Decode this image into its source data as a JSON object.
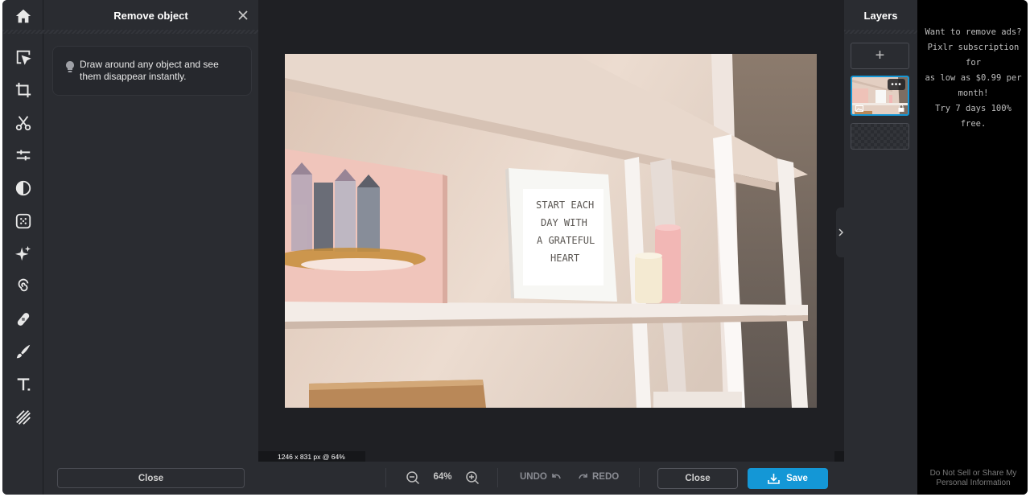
{
  "toolbar": {
    "items": [
      {
        "name": "home-icon"
      },
      {
        "name": "arrange-icon"
      },
      {
        "name": "crop-icon"
      },
      {
        "name": "cutout-icon"
      },
      {
        "name": "adjust-icon"
      },
      {
        "name": "filter-icon"
      },
      {
        "name": "effect-icon"
      },
      {
        "name": "ai-sparkle-icon"
      },
      {
        "name": "liquify-icon"
      },
      {
        "name": "retouch-icon"
      },
      {
        "name": "draw-icon"
      },
      {
        "name": "text-icon"
      },
      {
        "name": "pattern-icon"
      }
    ]
  },
  "panel": {
    "title": "Remove object",
    "tip": "Draw around any object and see them disappear instantly.",
    "close_label": "Close"
  },
  "canvas": {
    "size_label": "1246 x 831 px @ 64%",
    "poster_text": "START EACH DAY WITH A GRATEFUL HEART"
  },
  "bottombar": {
    "zoom": "64%",
    "undo_label": "UNDO",
    "redo_label": "REDO",
    "close_label": "Close",
    "save_label": "Save"
  },
  "layers": {
    "title": "Layers",
    "add_label": "+",
    "more_label": "•••"
  },
  "ad": {
    "lines": [
      "Want to remove ads?",
      "Pixlr subscription for",
      "as low as $0.99 per",
      "month!",
      "Try 7 days 100% free."
    ],
    "footer": "Do Not Sell or Share My Personal Information"
  },
  "colors": {
    "accent": "#1497d6",
    "panel_bg": "#2a2c31",
    "canvas_bg": "#1f2024"
  }
}
